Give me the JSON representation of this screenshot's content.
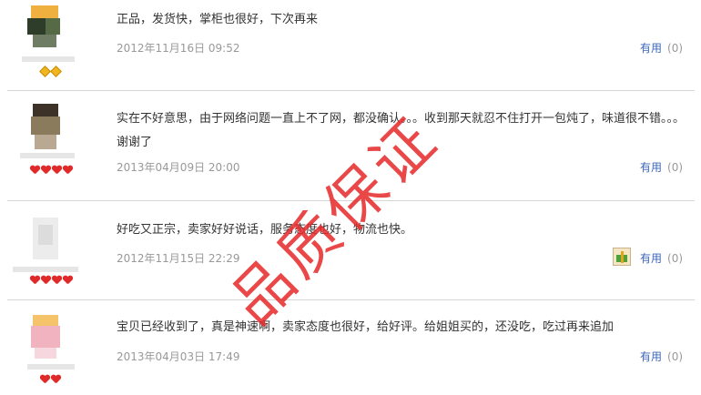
{
  "reviews": [
    {
      "text": "正品，发货快，掌柜也很好，下次再来",
      "date": "2012年11月16日 09:52",
      "useful_label": "有用",
      "useful_count": "(0)",
      "badge": "diamond"
    },
    {
      "text": "实在不好意思，由于网络问题一直上不了网，都没确认。。。收到那天就忍不住打开一包炖了，味道很不错。。。谢谢了",
      "date": "2013年04月09日 20:00",
      "useful_label": "有用",
      "useful_count": "(0)",
      "badge": "heart"
    },
    {
      "text": "好吃又正宗，卖家好好说话，服务态度也好，物流也快。",
      "date": "2012年11月15日 22:29",
      "useful_label": "有用",
      "useful_count": "(0)",
      "badge": "heart"
    },
    {
      "text": "宝贝已经收到了，真是神速啊，卖家态度也很好，给好评。给姐姐买的，还没吃，吃过再来追加",
      "date": "2013年04月03日 17:49",
      "useful_label": "有用",
      "useful_count": "(0)",
      "badge": "heart"
    }
  ],
  "watermark": "品质保证",
  "colors": {
    "useful": "#3b66b9",
    "date": "#999999",
    "divider": "#d6d6d6",
    "watermark": "#e62828"
  },
  "icons": {
    "gift": "gift-icon",
    "diamond": "diamond-badge-icon",
    "heart": "heart-badge-icon"
  }
}
